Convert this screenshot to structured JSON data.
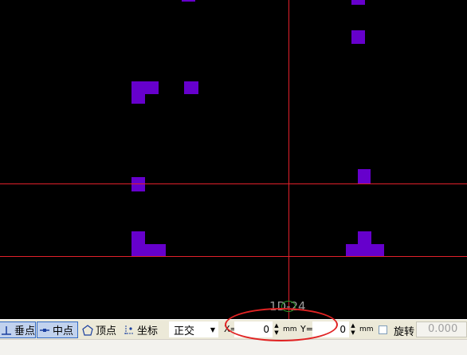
{
  "canvas": {
    "axis_label": "1D-24"
  },
  "toolbar": {
    "perpendicular_label": "垂点",
    "midpoint_label": "中点",
    "vertex_label": "顶点",
    "coordinate_label": "坐标",
    "ortho_mode_value": "正交",
    "x_label": "X=",
    "x_value": "0",
    "y_label": "Y=",
    "y_value": "0",
    "unit": "mm",
    "rotate_label": "旋转",
    "rotate_value": "0.000"
  },
  "colors": {
    "background": "#000000",
    "block": "#6600CC",
    "guide_line": "#E0202A",
    "toolbar": "#ECE9D8",
    "annotation_circle": "#E02323"
  }
}
